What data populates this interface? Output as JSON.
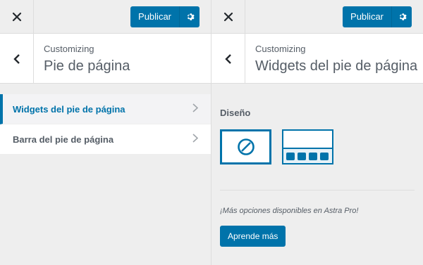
{
  "left": {
    "publish_label": "Publicar",
    "customizing": "Customizing",
    "title": "Pie de página",
    "items": [
      {
        "label": "Widgets del pie de página",
        "active": true
      },
      {
        "label": "Barra del pie de página",
        "active": false
      }
    ]
  },
  "right": {
    "publish_label": "Publicar",
    "customizing": "Customizing",
    "title": "Widgets del pie de página",
    "design_label": "Diseño",
    "layouts": [
      "disabled-icon",
      "four-columns-icon"
    ],
    "promo": "¡Más opciones disponibles en Astra Pro!",
    "learn_more": "Aprende más"
  },
  "colors": {
    "accent": "#0073aa",
    "panel_bg": "#eeeeee",
    "text": "#555d66"
  }
}
